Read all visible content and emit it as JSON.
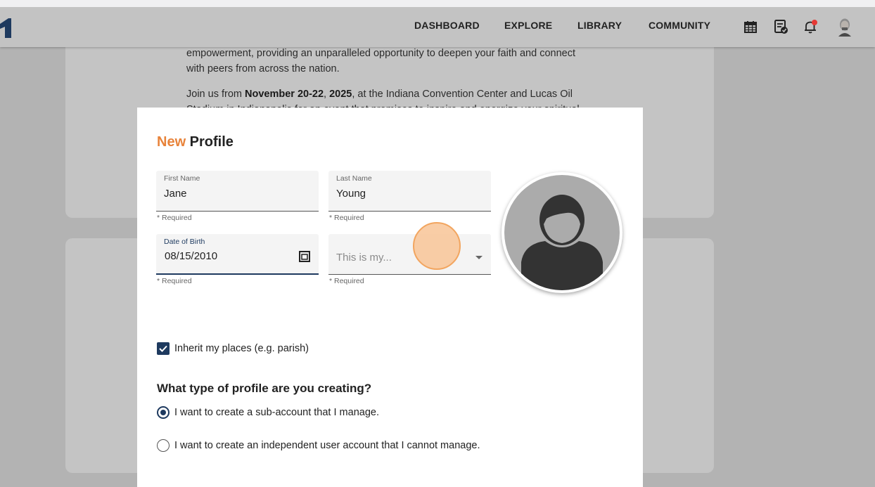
{
  "nav": {
    "links": [
      "DASHBOARD",
      "EXPLORE",
      "LIBRARY",
      "COMMUNITY"
    ],
    "notification_dot_color": "#e53935"
  },
  "background_card": {
    "line1": "empowerment, providing an unparalleled opportunity to deepen your faith and connect",
    "line2": "with peers from across the nation.",
    "line3_pre": "Join us from ",
    "line3_bold1": "November 20-22",
    "line3_sep": ", ",
    "line3_bold2": "2025",
    "line3_post": ", at the Indiana Convention Center and Lucas Oil",
    "line4": "Stadium in Indianapolis for an event that promises to inspire and energize your spiritual"
  },
  "modal": {
    "title_accent": "New",
    "title_rest": " Profile",
    "first_name": {
      "label": "First Name",
      "value": "Jane",
      "hint": "* Required"
    },
    "last_name": {
      "label": "Last Name",
      "value": "Young",
      "hint": "* Required"
    },
    "dob": {
      "label": "Date of Birth",
      "value": "08/15/2010",
      "hint": "* Required"
    },
    "relation": {
      "placeholder": "This is my...",
      "hint": "* Required"
    },
    "inherit_label": "Inherit my places (e.g. parish)",
    "question": "What type of profile are you creating?",
    "options": [
      "I want to create a sub-account that I manage.",
      "I want to create an independent user account that I cannot manage."
    ],
    "accent_color": "#e8833a",
    "primary_color": "#1e3a5f"
  }
}
